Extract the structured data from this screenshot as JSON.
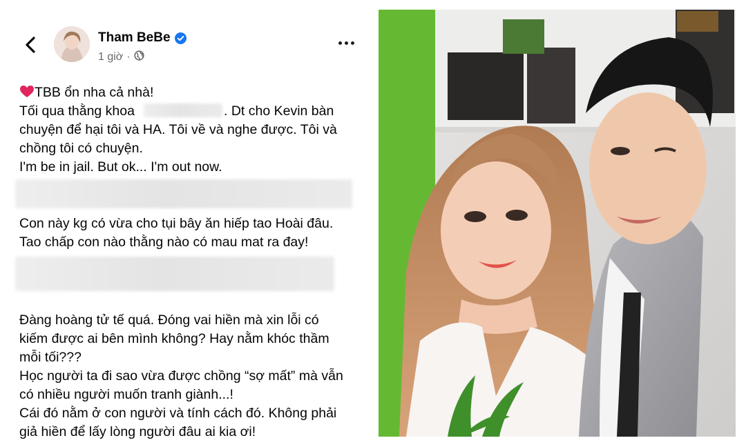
{
  "post": {
    "author": "Tham BeBe",
    "time": "1 giờ",
    "icons": {
      "back": "back-arrow-icon",
      "verified": "verified-badge-icon",
      "audience": "globe-icon",
      "more": "more-options-icon",
      "heart": "heart-emoji-icon"
    },
    "colors": {
      "verified": "#1877f2",
      "heart": "#e0245e",
      "meta": "#65676b"
    },
    "lines": [
      "TBB ổn nha cả nhà!",
      "Tối qua thằng khoa",
      ". Dt cho Kevin bàn",
      "chuyện để hại tôi và HA. Tôi về và nghe được. Tôi và",
      "chồng tôi có chuyện.",
      "I'm be in jail. But ok... I'm out now.",
      "Con này kg có vừa cho tụi bây ăn hiếp tao Hoài đâu.",
      "Tao chấp con nào thằng nào có mau mat ra đay!",
      "Đàng hoàng tử tế quá. Đóng vai hiền mà xin lỗi có",
      "kiếm được ai bên mình không? Hay nằm khóc thầm",
      "mỗi tối???",
      "Học người ta đi sao vừa được chồng “sợ mất” mà vẫn",
      "có nhiều người muốn tranh giành...!",
      "Cái đó nằm ở con người và tính cách đó. Không phải",
      "giả hiền để lấy lòng người đâu ai kia ơi!"
    ]
  },
  "photo": {
    "description_icon": "couple-selfie-photo"
  }
}
